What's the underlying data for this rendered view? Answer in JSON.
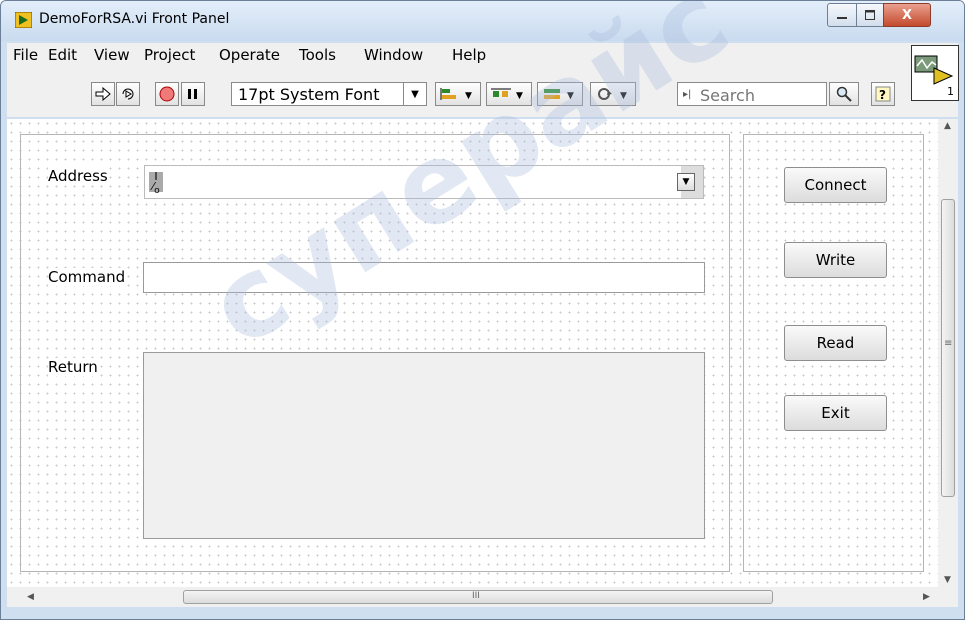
{
  "window": {
    "title": "DemoForRSA.vi Front Panel",
    "controls": {
      "minimize": "—",
      "maximize": "□",
      "close": "X"
    }
  },
  "menu": {
    "items": [
      {
        "label": "File"
      },
      {
        "label": "Edit"
      },
      {
        "label": "View"
      },
      {
        "label": "Project"
      },
      {
        "label": "Operate"
      },
      {
        "label": "Tools"
      },
      {
        "label": "Window"
      },
      {
        "label": "Help"
      }
    ]
  },
  "toolbar": {
    "font_select": "17pt System Font",
    "search_placeholder": "Search",
    "vi_icon_number": "1"
  },
  "panel": {
    "address_label": "Address",
    "address_value": "",
    "address_icon": "I/o",
    "command_label": "Command",
    "command_value": "",
    "return_label": "Return",
    "return_value": ""
  },
  "buttons": {
    "connect": "Connect",
    "write": "Write",
    "read": "Read",
    "exit": "Exit"
  },
  "scrollbar": {
    "h_grip": "III",
    "v_grip": "≡"
  },
  "watermark": "суперайс"
}
